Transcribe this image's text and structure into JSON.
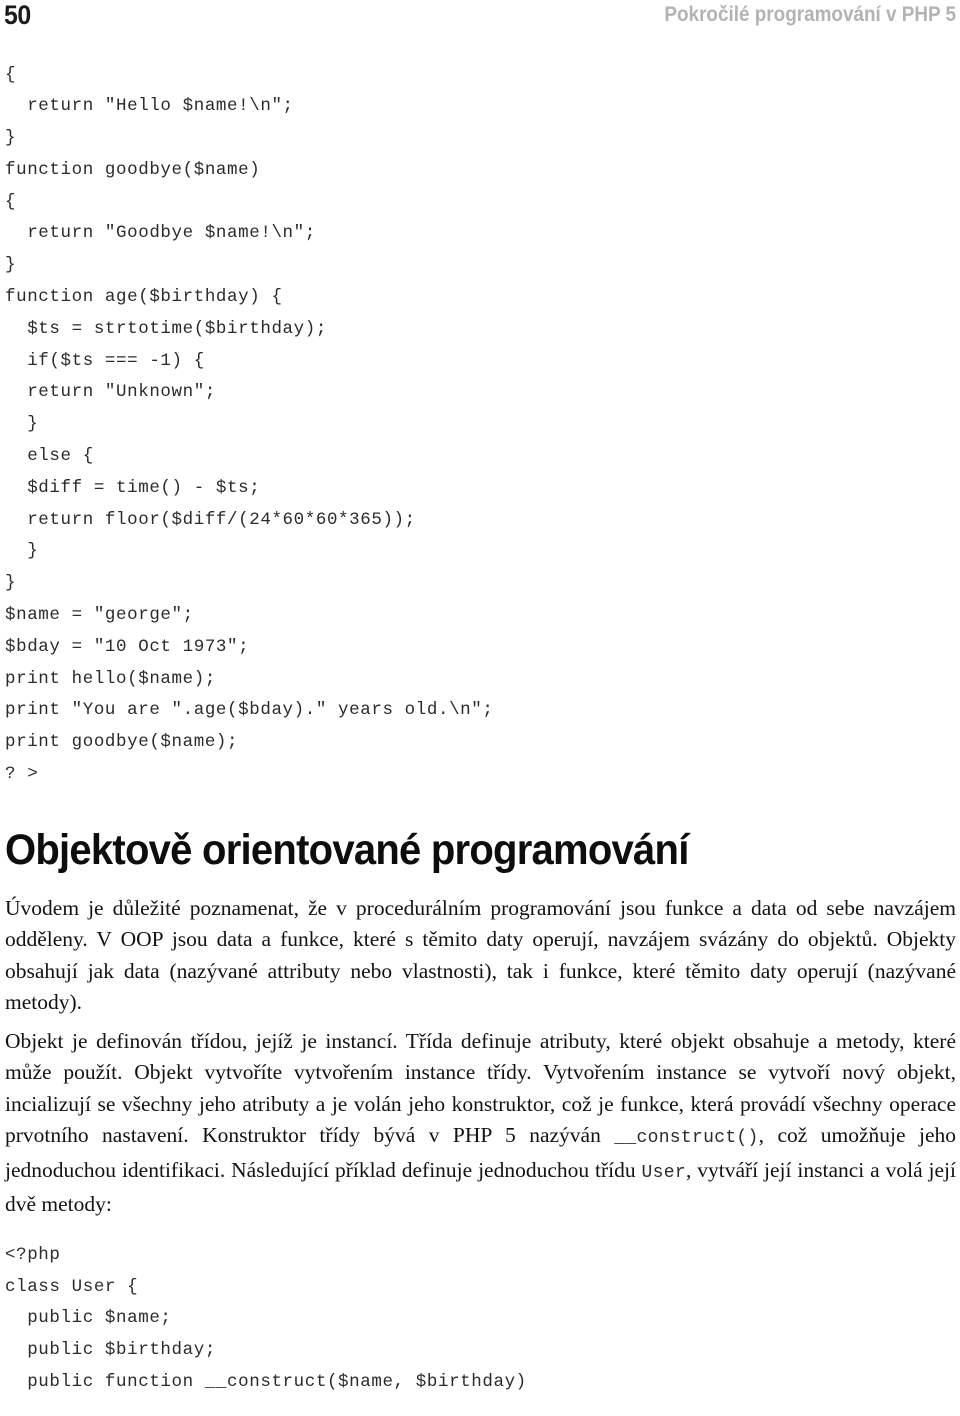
{
  "page": {
    "folio": "50",
    "running_title": "Pokročilé programování v PHP 5",
    "colors": {
      "text": "#121212",
      "running_title": "#b3b3b3",
      "code": "#2b2b2b",
      "background": "#ffffff"
    }
  },
  "code_top": {
    "lines": [
      "{",
      "  return \"Hello $name!\\n\";",
      "}",
      "function goodbye($name)",
      "{",
      "  return \"Goodbye $name!\\n\";",
      "}",
      "function age($birthday) {",
      "  $ts = strtotime($birthday);",
      "  if($ts === -1) {",
      "  return \"Unknown\";",
      "  }",
      "  else {",
      "  $diff = time() - $ts;",
      "  return floor($diff/(24*60*60*365));",
      "  }",
      "}",
      "$name = \"george\";",
      "$bday = \"10 Oct 1973\";",
      "print hello($name);",
      "print \"You are \".age($bday).\" years old.\\n\";",
      "print goodbye($name);",
      "? >"
    ]
  },
  "heading": "Objektově orientované programování",
  "paragraphs": [
    {
      "id": "para-1",
      "runs": [
        {
          "type": "text",
          "text": "Úvodem je důležité poznamenat, že v procedurálním programování jsou funkce a data od sebe navzájem odděleny. V OOP jsou data a funkce, které s těmito daty operují, navzájem svázány do objektů. Objekty obsahují jak data (nazývané attributy nebo vlastnosti), tak i funkce, které těmito daty operují (nazývané metody)."
        }
      ]
    },
    {
      "id": "para-2",
      "runs": [
        {
          "type": "text",
          "text": "Objekt je definován třídou, jejíž je instancí. Třída definuje atributy, které objekt obsahuje a metody, které může použít. Objekt vytvoříte vytvořením instance třídy. Vytvořením instance se vytvoří nový objekt, incializují se všechny jeho atributy a je volán jeho konstruktor, což je funkce, která provádí všechny operace prvotního nastavení. Konstruktor třídy bývá v PHP 5 nazýván "
        },
        {
          "type": "mono",
          "text": "__construct()"
        },
        {
          "type": "text",
          "text": ", což umožňuje jeho jednoduchou identifikaci. Následující příklad definuje jednoduchou třídu "
        },
        {
          "type": "mono",
          "text": "User"
        },
        {
          "type": "text",
          "text": ", vytváří její instanci a volá její dvě metody:"
        }
      ]
    }
  ],
  "code_bottom": {
    "lines": [
      "<?php",
      "class User {",
      "  public $name;",
      "  public $birthday;",
      "  public function __construct($name, $birthday)"
    ]
  }
}
